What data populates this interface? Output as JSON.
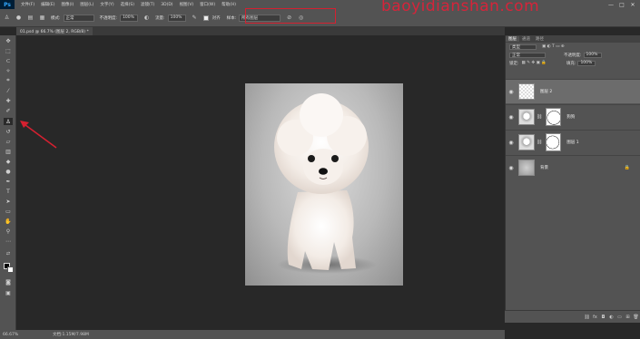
{
  "menubar": {
    "app_badge": "Ps",
    "items": [
      "文件(F)",
      "编辑(E)",
      "图像(I)",
      "图层(L)",
      "文字(Y)",
      "选择(S)",
      "滤镜(T)",
      "3D(D)",
      "视图(V)",
      "窗口(W)",
      "帮助(H)"
    ],
    "window_controls": [
      "—",
      "□",
      "✕"
    ]
  },
  "watermark": "baoyidianshan.com",
  "options": {
    "brush_label": "模式:",
    "mode_value": "正常",
    "opacity_label": "不透明度:",
    "opacity_value": "100%",
    "flow_label": "流量:",
    "flow_value": "100%",
    "aligned_label": "对齐",
    "sample_label": "样本:",
    "sample_value": "所有图层"
  },
  "document_tab": "01.psd @ 66.7% (图层 2, RGB/8) *",
  "statusbar": {
    "zoom": "66.67%",
    "info": "文档:1.15M/7.98M"
  },
  "layers_panel": {
    "tabs": [
      "图层",
      "通道",
      "路径"
    ],
    "filter_kind": "类型",
    "blend_mode": "正常",
    "opacity_label": "不透明度:",
    "opacity_value": "100%",
    "lock_label": "锁定:",
    "fill_label": "填充:",
    "fill_value": "100%",
    "layers": [
      {
        "name": "图层 2",
        "selected": true
      },
      {
        "name": "狗狗"
      },
      {
        "name": "图层 1"
      },
      {
        "name": "背景",
        "locked": true
      }
    ]
  },
  "colors": {
    "ui_panel": "#535353",
    "canvas_bg": "#282828",
    "highlight_red": "#d62030"
  }
}
